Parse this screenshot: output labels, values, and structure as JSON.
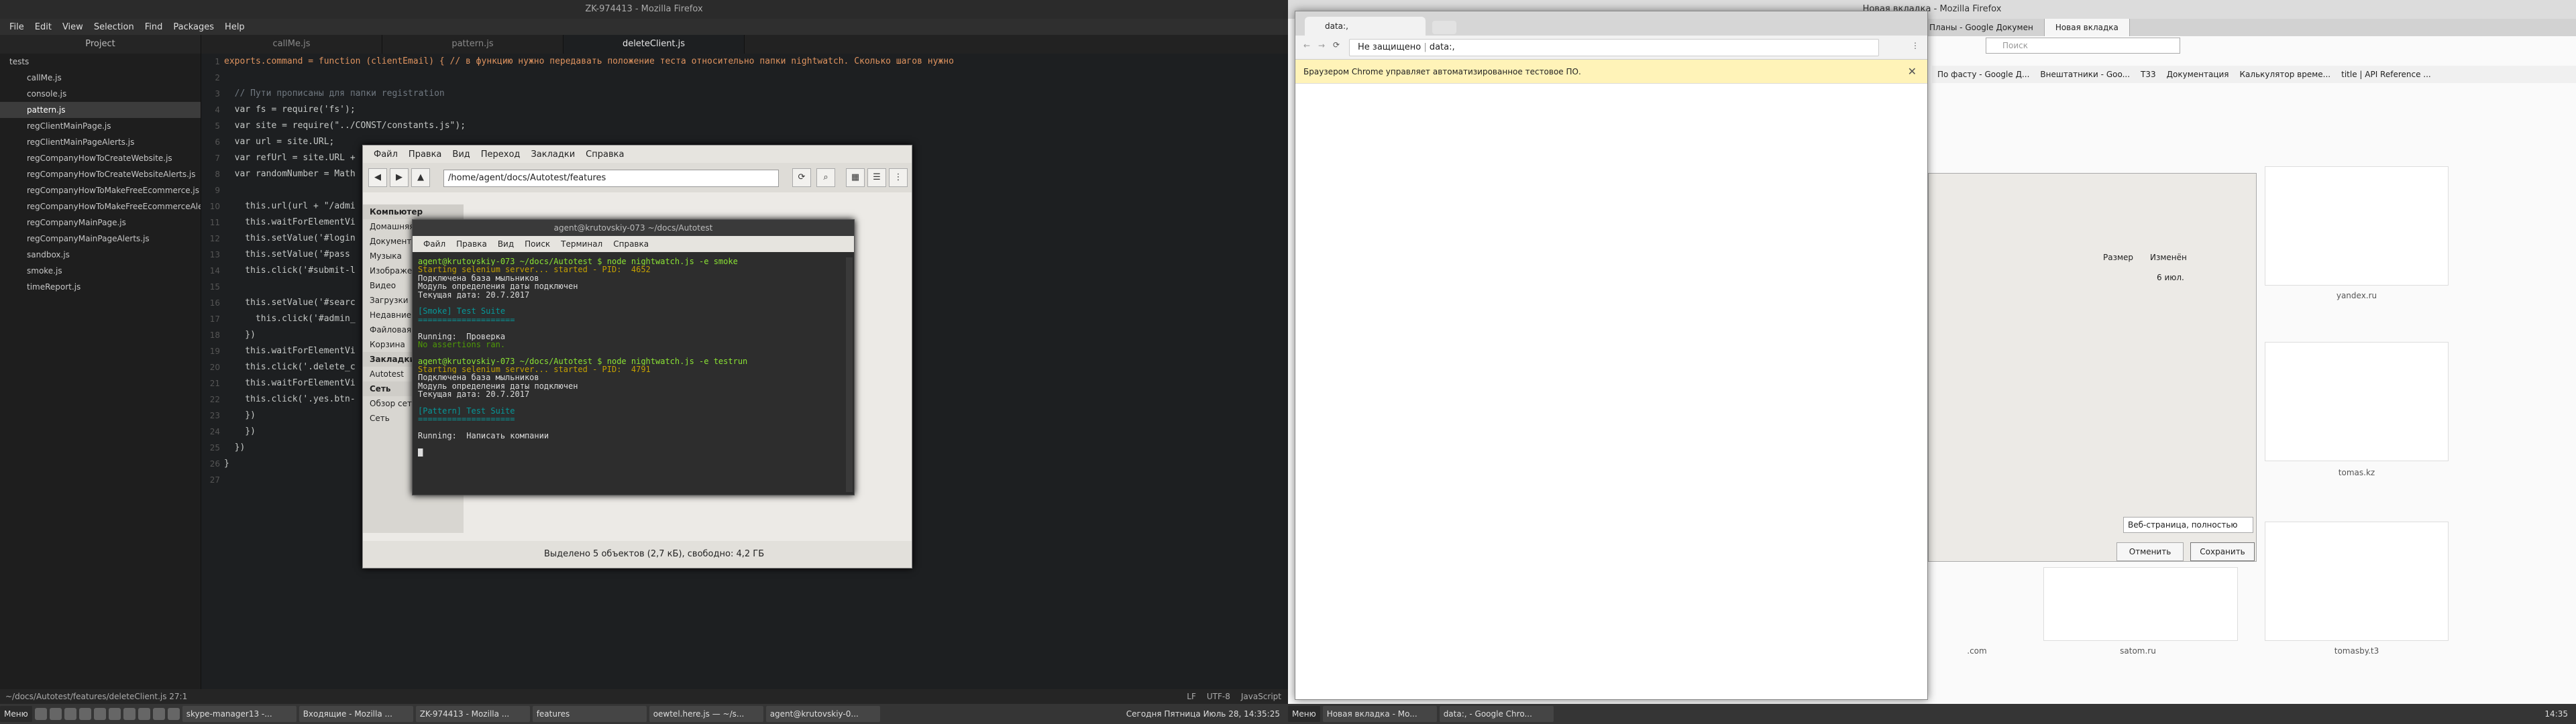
{
  "atom": {
    "title": "ZK-974413 - Mozilla Firefox",
    "menu": [
      "File",
      "Edit",
      "View",
      "Selection",
      "Find",
      "Packages",
      "Help"
    ],
    "project_label": "Project",
    "tabs": [
      "callMe.js",
      "pattern.js",
      "deleteClient.js"
    ],
    "tree": [
      {
        "label": "tests",
        "kind": "folder"
      },
      {
        "label": "callMe.js"
      },
      {
        "label": "console.js"
      },
      {
        "label": "pattern.js",
        "selected": true
      },
      {
        "label": "regClientMainPage.js"
      },
      {
        "label": "regClientMainPageAlerts.js"
      },
      {
        "label": "regCompanyHowToCreateWebsite.js"
      },
      {
        "label": "regCompanyHowToCreateWebsiteAlerts.js"
      },
      {
        "label": "regCompanyHowToMakeFreeEcommerce.js"
      },
      {
        "label": "regCompanyHowToMakeFreeEcommerceAle"
      },
      {
        "label": "regCompanyMainPage.js"
      },
      {
        "label": "regCompanyMainPageAlerts.js"
      },
      {
        "label": "sandbox.js"
      },
      {
        "label": "smoke.js"
      },
      {
        "label": "timeReport.js"
      }
    ],
    "code": [
      "exports.command = function (clientEmail) { // в функцию нужно передавать положение теста относительно папки nightwatch. Сколько шагов нужно",
      "",
      "  // Пути прописаны для папки registration",
      "  var fs = require('fs');",
      "  var site = require(\"../CONST/constants.js\");",
      "  var url = site.URL;",
      "  var refUrl = site.URL + '/auth/login/?ref=REF';",
      "  var randomNumber = Math",
      "",
      "    this.url(url + \"/admi",
      "    this.waitForElementVi",
      "    this.setValue('#login",
      "    this.setValue('#pass",
      "    this.click('#submit-l",
      "",
      "    this.setValue('#searc",
      "      this.click('#admin_",
      "    })",
      "    this.waitForElementVi",
      "    this.click('.delete_c",
      "    this.waitForElementVi",
      "    this.click('.yes.btn-",
      "    })",
      "    })",
      "  })",
      "}",
      ""
    ],
    "status_left": "~/docs/Autotest/features/deleteClient.js   27:1",
    "status_right": [
      "LF",
      "UTF-8",
      "JavaScript"
    ]
  },
  "filemanager": {
    "menu": [
      "Файл",
      "Правка",
      "Вид",
      "Переход",
      "Закладки",
      "Справка"
    ],
    "path": "/home/agent/docs/Autotest/features",
    "sidebar": [
      "Компьютер",
      "Домашняя папка",
      "Документы",
      "Музыка",
      "Изображения",
      "Видео",
      "Загрузки",
      "Недавние",
      "Файловая система",
      "Корзина",
      "Закладки",
      "Autotest",
      "Сеть",
      "Обзор сети",
      "Сеть"
    ],
    "status": "Выделено 5 объектов (2,7 кБ), свободно: 4,2 ГБ"
  },
  "terminal": {
    "title": "agent@krutovskiy-073 ~/docs/Autotest",
    "menu": [
      "Файл",
      "Правка",
      "Вид",
      "Поиск",
      "Терминал",
      "Справка"
    ],
    "lines": [
      {
        "t": "agent@krutovskiy-073 ~/docs/Autotest $ node nightwatch.js -e smoke",
        "c": "#8ae234"
      },
      {
        "t": "Starting selenium server... started - PID:  4652",
        "c": "#c4a000"
      },
      {
        "t": "Подключена база мыльников",
        "c": "#ddd"
      },
      {
        "t": "Модуль определения даты подключен",
        "c": "#ddd"
      },
      {
        "t": "Текущая дата: 20.7.2017",
        "c": "#ddd"
      },
      {
        "t": "",
        "c": "#ddd"
      },
      {
        "t": "[Smoke] Test Suite",
        "c": "#06989a"
      },
      {
        "t": "====================",
        "c": "#06989a"
      },
      {
        "t": "",
        "c": "#ddd"
      },
      {
        "t": "Running:  Проверка",
        "c": "#ddd"
      },
      {
        "t": "No assertions ran.",
        "c": "#4e9a06"
      },
      {
        "t": "",
        "c": "#ddd"
      },
      {
        "t": "agent@krutovskiy-073 ~/docs/Autotest $ node nightwatch.js -e testrun",
        "c": "#8ae234"
      },
      {
        "t": "Starting selenium server... started - PID:  4791",
        "c": "#c4a000"
      },
      {
        "t": "Подключена база мыльников",
        "c": "#ddd"
      },
      {
        "t": "Модуль определения даты подключен",
        "c": "#ddd"
      },
      {
        "t": "Текущая дата: 20.7.2017",
        "c": "#ddd"
      },
      {
        "t": "",
        "c": "#ddd"
      },
      {
        "t": "[Pattern] Test Suite",
        "c": "#06989a"
      },
      {
        "t": "====================",
        "c": "#06989a"
      },
      {
        "t": "",
        "c": "#ddd"
      },
      {
        "t": "Running:  Написать компании",
        "c": "#ddd"
      },
      {
        "t": "",
        "c": "#ddd"
      },
      {
        "t": "█",
        "c": "#ddd"
      }
    ]
  },
  "chrome": {
    "tab_label": "data:,",
    "security": "Не защищено",
    "url": "data:,",
    "infobar": "Браузером Chrome управляет автоматизированное тестовое ПО."
  },
  "firefox": {
    "title": "Новая вкладка - Mozilla Firefox",
    "tabs": [
      "Планы - Google Докумен",
      "Новая вкладка"
    ],
    "search_placeholder": "Поиск",
    "bookmarks": [
      "По фасту - Google Д...",
      "Внештатники - Goo...",
      "T33",
      "Документация",
      "Калькулятор време...",
      "title | API Reference ..."
    ],
    "dialog": {
      "col_size": "Размер",
      "col_changed": "Изменён",
      "date": "6 июл.",
      "save_type": "Веб-страница, полностью",
      "cancel": "Отменить",
      "save": "Сохранить"
    },
    "tiles": [
      "yandex.ru",
      "tomas.kz",
      "tomasby.t3",
      "satom.ru",
      ".com"
    ]
  },
  "taskbar_left": {
    "menu": "Меню",
    "items": [
      "skype-manager13 -...",
      "Входящие - Mozilla ...",
      "ZK-974413 - Mozilla ...",
      "features",
      "oewtel.here.js — ~/s...",
      "agent@krutovskiy-0..."
    ],
    "clock": "Сегодня Пятница Июль 28, 14:35:25"
  },
  "taskbar_right": {
    "menu": "Меню",
    "items": [
      "Новая вкладка - Mo...",
      "data:, - Google Chro..."
    ],
    "clock": "14:35"
  }
}
